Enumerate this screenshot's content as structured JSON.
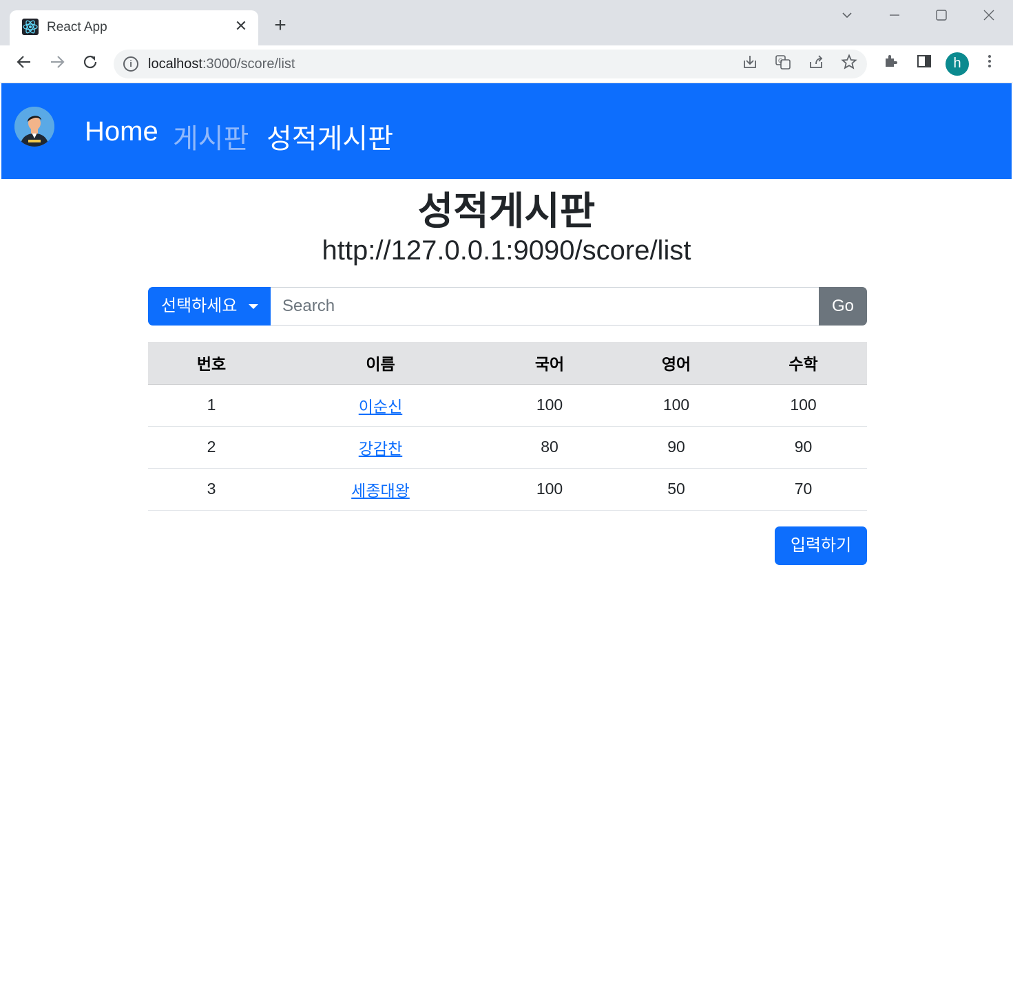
{
  "browser": {
    "tab_title": "React App",
    "url_host": "localhost",
    "url_path": ":3000/score/list",
    "profile_initial": "h"
  },
  "navbar": {
    "links": [
      "Home",
      "게시판",
      "성적게시판"
    ],
    "colors": {
      "bg": "#0d6efd",
      "active": "#ffffff",
      "muted": "#8fb8fb"
    }
  },
  "main": {
    "title": "성적게시판",
    "subtitle": "http://127.0.0.1:9090/score/list",
    "search": {
      "dropdown_label": "선택하세요",
      "placeholder": "Search",
      "go_label": "Go"
    },
    "table": {
      "headers": [
        "번호",
        "이름",
        "국어",
        "영어",
        "수학"
      ],
      "rows": [
        {
          "num": "1",
          "name": "이순신",
          "kor": "100",
          "eng": "100",
          "math": "100"
        },
        {
          "num": "2",
          "name": "강감찬",
          "kor": "80",
          "eng": "90",
          "math": "90"
        },
        {
          "num": "3",
          "name": "세종대왕",
          "kor": "100",
          "eng": "50",
          "math": "70"
        }
      ]
    },
    "write_button": "입력하기"
  }
}
